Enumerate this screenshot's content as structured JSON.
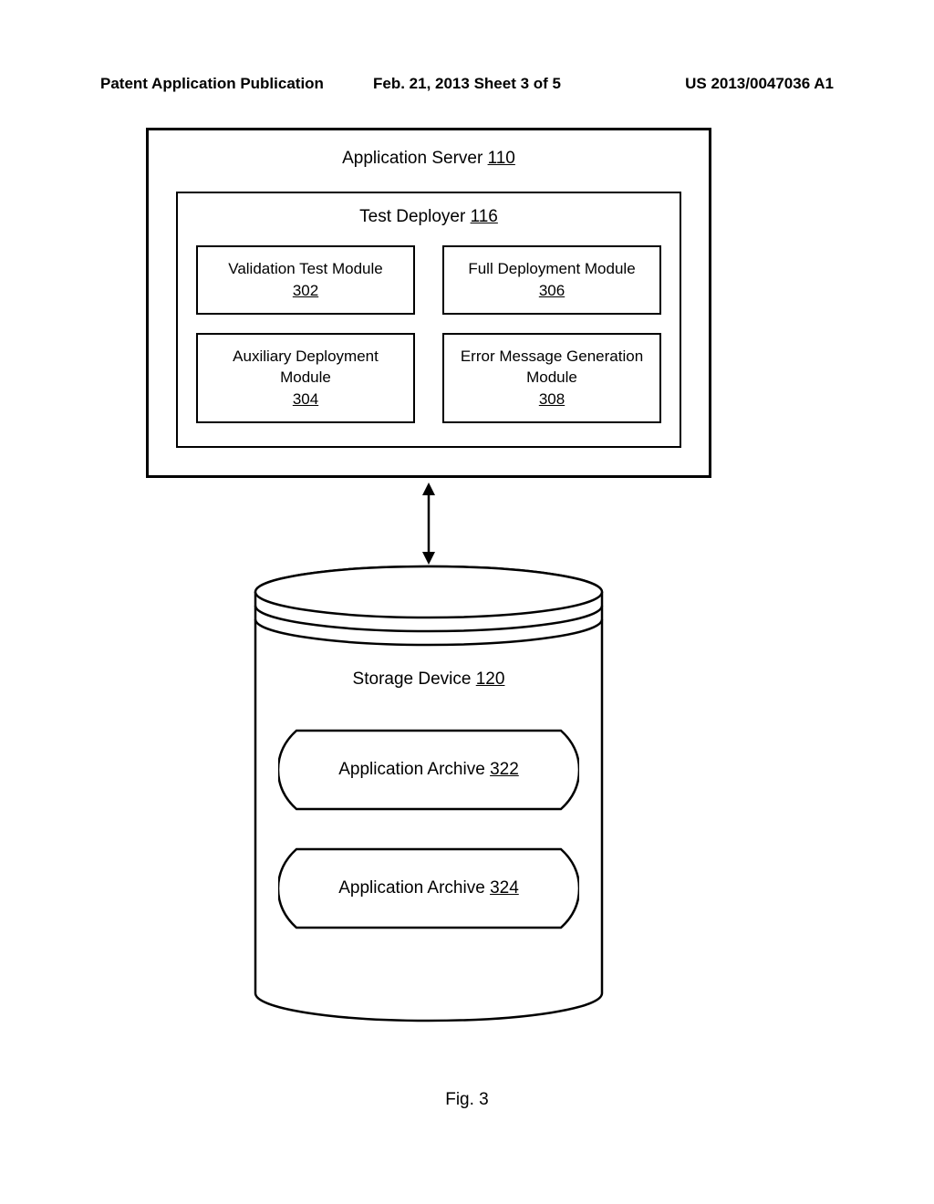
{
  "header": {
    "left": "Patent Application Publication",
    "center": "Feb. 21, 2013  Sheet 3 of 5",
    "right": "US 2013/0047036 A1"
  },
  "app_server": {
    "label": "Application Server ",
    "ref": "110"
  },
  "test_deployer": {
    "label": "Test Deployer ",
    "ref": "116"
  },
  "modules": [
    {
      "label": "Validation Test Module",
      "ref": "302"
    },
    {
      "label": "Full Deployment Module",
      "ref": "306"
    },
    {
      "label": "Auxiliary Deployment Module",
      "ref": "304"
    },
    {
      "label": "Error Message Generation Module",
      "ref": "308"
    }
  ],
  "storage": {
    "label": "Storage Device ",
    "ref": "120"
  },
  "archives": [
    {
      "label": "Application Archive ",
      "ref": "322"
    },
    {
      "label": "Application Archive ",
      "ref": "324"
    }
  ],
  "figure": "Fig. 3"
}
